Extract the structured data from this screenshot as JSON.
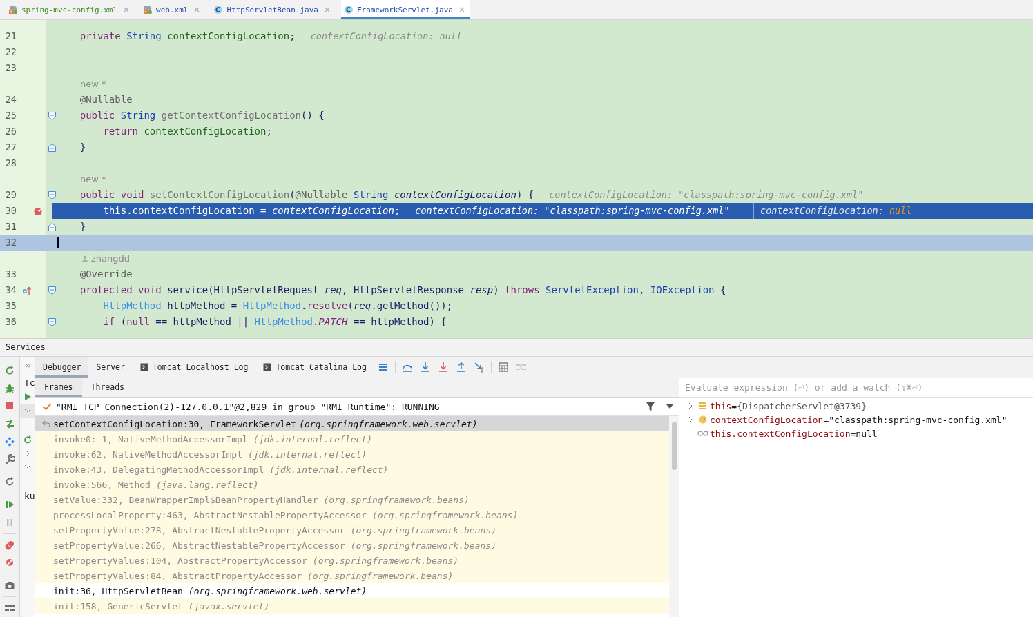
{
  "editor_tabs": [
    {
      "label": "spring-mvc-config.xml",
      "kind": "xml",
      "color": "#3a8a1b",
      "selected": false
    },
    {
      "label": "web.xml",
      "kind": "xml",
      "color": "#2149b0",
      "selected": false
    },
    {
      "label": "HttpServletBean.java",
      "kind": "class",
      "color": "#2149b0",
      "selected": false
    },
    {
      "label": "FrameworkServlet.java",
      "kind": "class",
      "color": "#2149b0",
      "selected": true
    }
  ],
  "code_lines": [
    {
      "kind": "code",
      "number": "21",
      "tokens": [
        {
          "text": "    private ",
          "kind": "keyword"
        },
        {
          "text": "String ",
          "kind": "type"
        },
        {
          "text": "contextConfigLocation",
          "kind": "field"
        },
        {
          "text": ";",
          "kind": "plain"
        }
      ],
      "hint": [
        {
          "text": "contextConfigLocation: null",
          "kind": "hint"
        }
      ]
    },
    {
      "kind": "code",
      "number": "22"
    },
    {
      "kind": "code",
      "number": "23"
    },
    {
      "kind": "inlay",
      "text": "new *"
    },
    {
      "kind": "code",
      "number": "24",
      "tokens": [
        {
          "text": "    @Nullable",
          "kind": "annotation"
        }
      ]
    },
    {
      "kind": "code",
      "number": "25",
      "fold_start": true,
      "tokens": [
        {
          "text": "    public ",
          "kind": "keyword"
        },
        {
          "text": "String ",
          "kind": "type"
        },
        {
          "text": "getContextConfigLocation",
          "kind": "unused"
        },
        {
          "text": "() {",
          "kind": "plain"
        }
      ]
    },
    {
      "kind": "code",
      "number": "26",
      "tokens": [
        {
          "text": "        return ",
          "kind": "keyword"
        },
        {
          "text": "contextConfigLocation",
          "kind": "field"
        },
        {
          "text": ";",
          "kind": "plain"
        }
      ]
    },
    {
      "kind": "code",
      "number": "27",
      "fold_end": true,
      "tokens": [
        {
          "text": "    }",
          "kind": "plain"
        }
      ]
    },
    {
      "kind": "code",
      "number": "28"
    },
    {
      "kind": "inlay",
      "text": "new *"
    },
    {
      "kind": "code",
      "number": "29",
      "fold_start": true,
      "tokens": [
        {
          "text": "    public void ",
          "kind": "keyword"
        },
        {
          "text": "setContextConfigLocation",
          "kind": "unused"
        },
        {
          "text": "(",
          "kind": "plain"
        },
        {
          "text": "@Nullable ",
          "kind": "annotation"
        },
        {
          "text": "String ",
          "kind": "type"
        },
        {
          "text": "contextConfigLocation",
          "kind": "param"
        },
        {
          "text": ") {",
          "kind": "plain"
        }
      ],
      "hint": [
        {
          "text": "contextConfigLocation: \"classpath:spring-mvc-config.xml\"",
          "kind": "hint"
        }
      ]
    },
    {
      "kind": "code",
      "number": "30",
      "execution_point": true,
      "breakpoint": true,
      "tokens": [
        {
          "text": "        this",
          "kind": "keyword"
        },
        {
          "text": ".",
          "kind": "plain"
        },
        {
          "text": "contextConfigLocation",
          "kind": "field"
        },
        {
          "text": " = ",
          "kind": "plain"
        },
        {
          "text": "contextConfigLocation",
          "kind": "param"
        },
        {
          "text": ";",
          "kind": "plain"
        }
      ],
      "hint": [
        {
          "text": "contextConfigLocation: \"classpath:spring-mvc-config.xml\"",
          "kind": "hint"
        }
      ],
      "margin_hint": [
        {
          "text": "contextConfigLocation: ",
          "kind": "hint"
        },
        {
          "text": "null",
          "kind": "null"
        }
      ]
    },
    {
      "kind": "code",
      "number": "31",
      "fold_end": true,
      "tokens": [
        {
          "text": "    }",
          "kind": "plain"
        }
      ]
    },
    {
      "kind": "code",
      "number": "32",
      "caret_line": true
    },
    {
      "kind": "author",
      "text": "zhangdd"
    },
    {
      "kind": "code",
      "number": "33",
      "tokens": [
        {
          "text": "    @Override",
          "kind": "annotation"
        }
      ]
    },
    {
      "kind": "code",
      "number": "34",
      "fold_start": true,
      "override": true,
      "tokens": [
        {
          "text": "    protected void ",
          "kind": "keyword"
        },
        {
          "text": "service",
          "kind": "method"
        },
        {
          "text": "(HttpServletRequest ",
          "kind": "plain"
        },
        {
          "text": "req",
          "kind": "param"
        },
        {
          "text": ", HttpServletResponse ",
          "kind": "plain"
        },
        {
          "text": "resp",
          "kind": "param"
        },
        {
          "text": ") ",
          "kind": "plain"
        },
        {
          "text": "throws ",
          "kind": "keyword"
        },
        {
          "text": "ServletException",
          "kind": "type"
        },
        {
          "text": ", ",
          "kind": "plain"
        },
        {
          "text": "IOException",
          "kind": "type"
        },
        {
          "text": " {",
          "kind": "plain"
        }
      ]
    },
    {
      "kind": "code",
      "number": "35",
      "tokens": [
        {
          "text": "        HttpMethod",
          "kind": "class"
        },
        {
          "text": " httpMethod = ",
          "kind": "plain"
        },
        {
          "text": "HttpMethod",
          "kind": "class"
        },
        {
          "text": ".",
          "kind": "plain"
        },
        {
          "text": "resolve",
          "kind": "call"
        },
        {
          "text": "(",
          "kind": "plain"
        },
        {
          "text": "req",
          "kind": "param"
        },
        {
          "text": ".getMethod());",
          "kind": "plain"
        }
      ]
    },
    {
      "kind": "code",
      "number": "36",
      "fold_start": true,
      "tokens": [
        {
          "text": "        if",
          "kind": "keyword"
        },
        {
          "text": " (",
          "kind": "plain"
        },
        {
          "text": "null",
          "kind": "keyword"
        },
        {
          "text": " == httpMethod || ",
          "kind": "plain"
        },
        {
          "text": "HttpMethod",
          "kind": "class"
        },
        {
          "text": ".",
          "kind": "plain"
        },
        {
          "text": "PATCH",
          "kind": "constant"
        },
        {
          "text": " == httpMethod) {",
          "kind": "plain"
        }
      ]
    }
  ],
  "services": {
    "title": "Services",
    "tree": [
      {
        "label": "Tc"
      },
      {
        "label": "ku"
      }
    ],
    "tabs": [
      {
        "label": "Debugger",
        "kind": "plain",
        "selected": true
      },
      {
        "label": "Server",
        "kind": "plain",
        "selected": false
      },
      {
        "label": "Tomcat Localhost Log",
        "kind": "console",
        "selected": false
      },
      {
        "label": "Tomcat Catalina Log",
        "kind": "console",
        "selected": false
      }
    ]
  },
  "frames_panel": {
    "tabs": [
      {
        "label": "Frames",
        "selected": true
      },
      {
        "label": "Threads",
        "selected": false
      }
    ],
    "thread": "\"RMI TCP Connection(2)-127.0.0.1\"@2,829 in group \"RMI Runtime\": RUNNING",
    "frames": [
      {
        "location": "setContextConfigLocation:30, FrameworkServlet",
        "package": "(org.springframework.web.servlet)",
        "kind": "project",
        "selected": true
      },
      {
        "location": "invoke0:-1, NativeMethodAccessorImpl",
        "package": "(jdk.internal.reflect)",
        "kind": "library",
        "selected": false
      },
      {
        "location": "invoke:62, NativeMethodAccessorImpl",
        "package": "(jdk.internal.reflect)",
        "kind": "library",
        "selected": false
      },
      {
        "location": "invoke:43, DelegatingMethodAccessorImpl",
        "package": "(jdk.internal.reflect)",
        "kind": "library",
        "selected": false
      },
      {
        "location": "invoke:566, Method",
        "package": "(java.lang.reflect)",
        "kind": "library",
        "selected": false
      },
      {
        "location": "setValue:332, BeanWrapperImpl$BeanPropertyHandler",
        "package": "(org.springframework.beans)",
        "kind": "library",
        "selected": false
      },
      {
        "location": "processLocalProperty:463, AbstractNestablePropertyAccessor",
        "package": "(org.springframework.beans)",
        "kind": "library",
        "selected": false
      },
      {
        "location": "setPropertyValue:278, AbstractNestablePropertyAccessor",
        "package": "(org.springframework.beans)",
        "kind": "library",
        "selected": false
      },
      {
        "location": "setPropertyValue:266, AbstractNestablePropertyAccessor",
        "package": "(org.springframework.beans)",
        "kind": "library",
        "selected": false
      },
      {
        "location": "setPropertyValues:104, AbstractPropertyAccessor",
        "package": "(org.springframework.beans)",
        "kind": "library",
        "selected": false
      },
      {
        "location": "setPropertyValues:84, AbstractPropertyAccessor",
        "package": "(org.springframework.beans)",
        "kind": "library",
        "selected": false
      },
      {
        "location": "init:36, HttpServletBean",
        "package": "(org.springframework.web.servlet)",
        "kind": "project",
        "selected": false
      },
      {
        "location": "init:158, GenericServlet",
        "package": "(javax.servlet)",
        "kind": "library",
        "selected": false
      }
    ]
  },
  "variables_panel": {
    "placeholder": "Evaluate expression (⏎) or add a watch (⇧⌘⏎)",
    "variables": [
      {
        "name": "this",
        "operator": "=",
        "value": "{DispatcherServlet@3739}",
        "kind": "object",
        "expandable": true
      },
      {
        "name": "contextConfigLocation",
        "operator": "=",
        "value": "\"classpath:spring-mvc-config.xml\"",
        "kind": "parameter",
        "expandable": true
      },
      {
        "name": "this.contextConfigLocation",
        "operator": "=",
        "value": "null",
        "kind": "watch",
        "expandable": false
      }
    ]
  }
}
